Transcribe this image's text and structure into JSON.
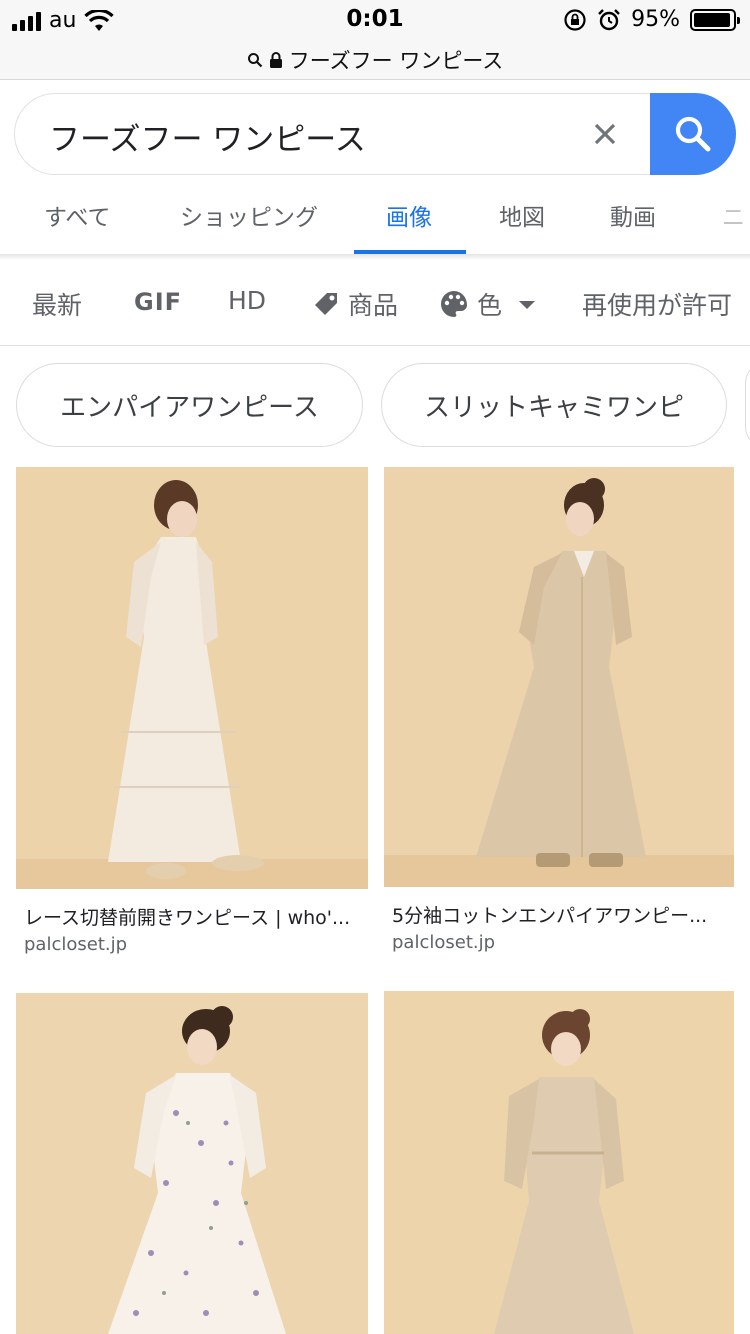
{
  "status": {
    "carrier": "au",
    "time": "0:01",
    "battery": "95%",
    "battery_level": 0.95
  },
  "urlbar": {
    "text": "フーズフー ワンピース"
  },
  "search": {
    "query": "フーズフー ワンピース"
  },
  "tabs": [
    {
      "label": "すべて"
    },
    {
      "label": "ショッピング"
    },
    {
      "label": "画像"
    },
    {
      "label": "地図"
    },
    {
      "label": "動画"
    },
    {
      "label": "ニ"
    }
  ],
  "filters": [
    {
      "label": "最新"
    },
    {
      "label": "GIF"
    },
    {
      "label": "HD"
    },
    {
      "label": "商品"
    },
    {
      "label": "色"
    },
    {
      "label": "再使用が許可"
    }
  ],
  "chips": [
    {
      "label": "エンパイアワンピース"
    },
    {
      "label": "スリットキャミワンピ"
    }
  ],
  "results": [
    {
      "title": "レース切替前開きワンピース | who'...",
      "source": "palcloset.jp"
    },
    {
      "title": "5分袖コットンエンパイアワンピー...",
      "source": "palcloset.jp"
    },
    {
      "title": "",
      "source": ""
    },
    {
      "title": "",
      "source": ""
    }
  ],
  "colors": {
    "accent": "#1a73e8",
    "search_button": "#4285f4",
    "photo_bg": "#ecd4ac"
  }
}
